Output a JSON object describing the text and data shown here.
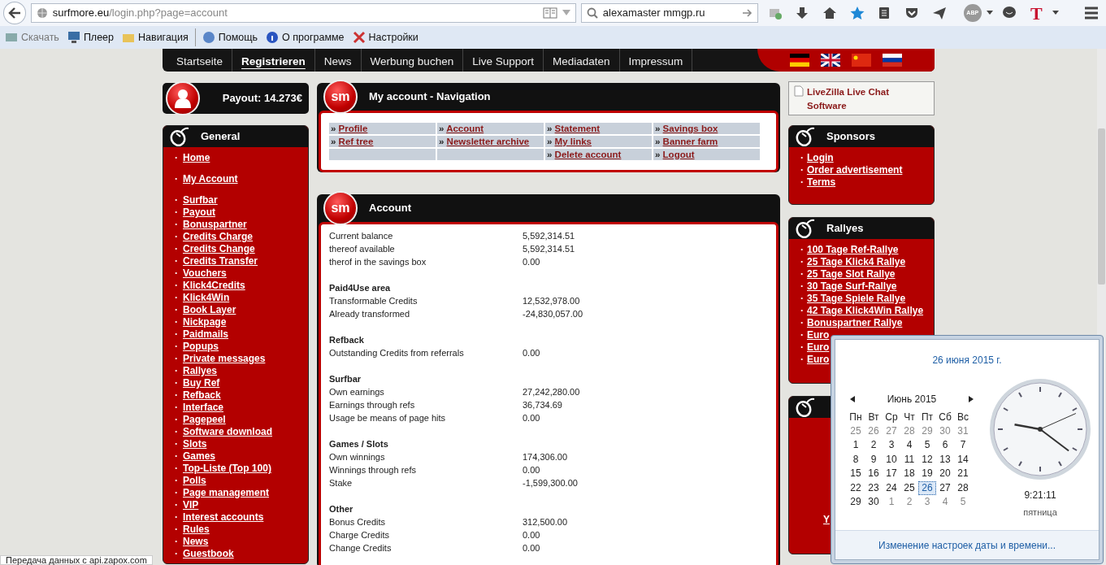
{
  "browser": {
    "url_host": "surfmore.eu",
    "url_path": "/login.php?page=account",
    "search_value": "alexamaster mmgp.ru",
    "abp_label": "ABP",
    "t_logo": "T"
  },
  "bookmarks": [
    {
      "label": "Скачать",
      "disabled": true
    },
    {
      "label": "Плеер",
      "disabled": false
    },
    {
      "label": "Навигация",
      "disabled": false
    },
    {
      "label": "Помощь",
      "disabled": false
    },
    {
      "label": "О программе",
      "disabled": false
    },
    {
      "label": "Настройки",
      "disabled": false
    }
  ],
  "top_nav": [
    {
      "label": "Startseite",
      "selected": false
    },
    {
      "label": "Registrieren",
      "selected": true
    },
    {
      "label": "News",
      "selected": false
    },
    {
      "label": "Werbung buchen",
      "selected": false
    },
    {
      "label": "Live Support",
      "selected": false
    },
    {
      "label": "Mediadaten",
      "selected": false
    },
    {
      "label": "Impressum",
      "selected": false
    }
  ],
  "payout": "Payout: 14.273€",
  "bullet": "·",
  "sidebar": {
    "title": "General",
    "groups": [
      [
        "Home"
      ],
      [
        "My Account"
      ],
      [
        "Surfbar",
        "Payout",
        "Bonuspartner",
        "Credits Charge",
        "Credits Change",
        "Credits Transfer",
        "Vouchers",
        "Klick4Credits",
        "Klick4Win",
        "Book Layer",
        "Nickpage",
        "Paidmails",
        "Popups",
        "Private messages",
        "Rallyes",
        "Buy Ref",
        "Refback",
        "Interface",
        "Pagepeel",
        "Software download",
        "Slots",
        "Games",
        "Top-Liste (Top 100)",
        "Polls",
        "Page management",
        "VIP",
        "Interest accounts",
        "Rules",
        "News",
        "Guestbook"
      ]
    ]
  },
  "nav_panel": {
    "logo": "sm",
    "title": "My account - Navigation",
    "marker": "»",
    "columns": [
      [
        "Profile",
        "Ref tree"
      ],
      [
        "Account",
        "Newsletter archive"
      ],
      [
        "Statement",
        "My links",
        "Delete account"
      ],
      [
        "Savings box",
        "Banner farm",
        "Logout"
      ]
    ]
  },
  "account": {
    "logo": "sm",
    "title": "Account",
    "sections": [
      {
        "rows": [
          [
            "Current balance",
            "5,592,314.51"
          ],
          [
            "thereof available",
            "5,592,314.51"
          ],
          [
            "therof in the savings box",
            "0.00"
          ]
        ]
      },
      {
        "heading": "Paid4Use area",
        "rows": [
          [
            "Transformable Credits",
            "12,532,978.00"
          ],
          [
            "Already transformed",
            "-24,830,057.00"
          ]
        ]
      },
      {
        "heading": "Refback",
        "rows": [
          [
            "Outstanding Credits from referrals",
            "0.00"
          ]
        ]
      },
      {
        "heading": "Surfbar",
        "rows": [
          [
            "Own earnings",
            "27,242,280.00"
          ],
          [
            "Earnings through refs",
            "36,734.69"
          ],
          [
            "Usage be means of page hits",
            "0.00"
          ]
        ]
      },
      {
        "heading": "Games / Slots",
        "rows": [
          [
            "Own winnings",
            "174,306.00"
          ],
          [
            "Winnings through refs",
            "0.00"
          ],
          [
            "Stake",
            "-1,599,300.00"
          ]
        ]
      },
      {
        "heading": "Other",
        "rows": [
          [
            "Bonus Credits",
            "312,500.00"
          ],
          [
            "Charge Credits",
            "0.00"
          ],
          [
            "Change Credits",
            "0.00"
          ]
        ]
      }
    ]
  },
  "livezilla": "LiveZilla Live Chat Software",
  "sponsors": {
    "title": "Sponsors",
    "items": [
      "Login",
      "Order advertisement",
      "Terms"
    ]
  },
  "rallyes": {
    "title": "Rallyes",
    "items": [
      "100 Tage Ref-Rallye",
      "25 Tage Klick4 Rallye",
      "25 Tage Slot Rallye",
      "30 Tage Surf-Rallye",
      "35 Tage Spiele Rallye",
      "42 Tage Klick4Win Rallye",
      "Bonuspartner Rallye",
      "Euro",
      "Euro",
      "Euro"
    ]
  },
  "third_panel": {
    "visible_text": "Y"
  },
  "calendar": {
    "date_heading": "26 июня 2015 г.",
    "month": "Июнь 2015",
    "weekdays": [
      "Пн",
      "Вт",
      "Ср",
      "Чт",
      "Пт",
      "Сб",
      "Вс"
    ],
    "days": [
      {
        "label": "25",
        "muted": true,
        "selected": false
      },
      {
        "label": "26",
        "muted": true,
        "selected": false
      },
      {
        "label": "27",
        "muted": true,
        "selected": false
      },
      {
        "label": "28",
        "muted": true,
        "selected": false
      },
      {
        "label": "29",
        "muted": true,
        "selected": false
      },
      {
        "label": "30",
        "muted": true,
        "selected": false
      },
      {
        "label": "31",
        "muted": true,
        "selected": false
      },
      {
        "label": "1",
        "muted": false,
        "selected": false
      },
      {
        "label": "2",
        "muted": false,
        "selected": false
      },
      {
        "label": "3",
        "muted": false,
        "selected": false
      },
      {
        "label": "4",
        "muted": false,
        "selected": false
      },
      {
        "label": "5",
        "muted": false,
        "selected": false
      },
      {
        "label": "6",
        "muted": false,
        "selected": false
      },
      {
        "label": "7",
        "muted": false,
        "selected": false
      },
      {
        "label": "8",
        "muted": false,
        "selected": false
      },
      {
        "label": "9",
        "muted": false,
        "selected": false
      },
      {
        "label": "10",
        "muted": false,
        "selected": false
      },
      {
        "label": "11",
        "muted": false,
        "selected": false
      },
      {
        "label": "12",
        "muted": false,
        "selected": false
      },
      {
        "label": "13",
        "muted": false,
        "selected": false
      },
      {
        "label": "14",
        "muted": false,
        "selected": false
      },
      {
        "label": "15",
        "muted": false,
        "selected": false
      },
      {
        "label": "16",
        "muted": false,
        "selected": false
      },
      {
        "label": "17",
        "muted": false,
        "selected": false
      },
      {
        "label": "18",
        "muted": false,
        "selected": false
      },
      {
        "label": "19",
        "muted": false,
        "selected": false
      },
      {
        "label": "20",
        "muted": false,
        "selected": false
      },
      {
        "label": "21",
        "muted": false,
        "selected": false
      },
      {
        "label": "22",
        "muted": false,
        "selected": false
      },
      {
        "label": "23",
        "muted": false,
        "selected": false
      },
      {
        "label": "24",
        "muted": false,
        "selected": false
      },
      {
        "label": "25",
        "muted": false,
        "selected": false
      },
      {
        "label": "26",
        "muted": false,
        "selected": true
      },
      {
        "label": "27",
        "muted": false,
        "selected": false
      },
      {
        "label": "28",
        "muted": false,
        "selected": false
      },
      {
        "label": "29",
        "muted": false,
        "selected": false
      },
      {
        "label": "30",
        "muted": false,
        "selected": false
      },
      {
        "label": "1",
        "muted": true,
        "selected": false
      },
      {
        "label": "2",
        "muted": true,
        "selected": false
      },
      {
        "label": "3",
        "muted": true,
        "selected": false
      },
      {
        "label": "4",
        "muted": true,
        "selected": false
      },
      {
        "label": "5",
        "muted": true,
        "selected": false
      }
    ],
    "time": "9:21:11",
    "weekday": "пятница",
    "settings_link": "Изменение настроек даты и времени..."
  },
  "status": "Передача данных с api.zapox.com"
}
